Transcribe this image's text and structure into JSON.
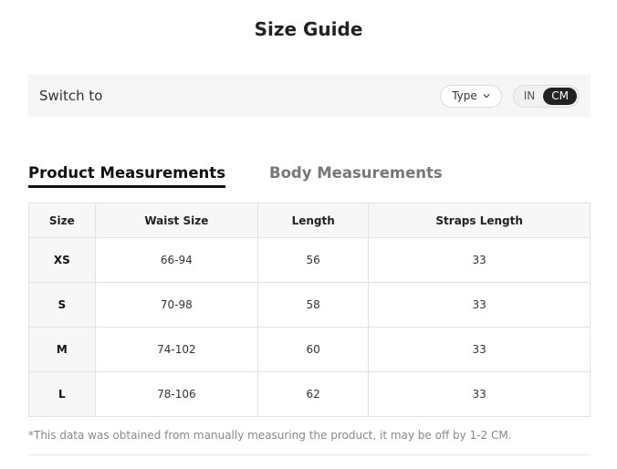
{
  "page": {
    "title": "Size Guide"
  },
  "switch_bar": {
    "label": "Switch to",
    "type_select": {
      "value": "Type",
      "icon": "chevron-down-icon"
    },
    "units": [
      {
        "label": "IN",
        "active": false
      },
      {
        "label": "CM",
        "active": true
      }
    ]
  },
  "tabs": [
    {
      "label": "Product Measurements",
      "active": true
    },
    {
      "label": "Body Measurements",
      "active": false
    }
  ],
  "table": {
    "headers": [
      "Size",
      "Waist Size",
      "Length",
      "Straps Length"
    ],
    "rows": [
      [
        "XS",
        "66-94",
        "56",
        "33"
      ],
      [
        "S",
        "70-98",
        "58",
        "33"
      ],
      [
        "M",
        "74-102",
        "60",
        "33"
      ],
      [
        "L",
        "78-106",
        "62",
        "33"
      ]
    ]
  },
  "note": "*This data was obtained from manually measuring the product, it may be off by 1-2 CM.",
  "colors": {
    "accent": "#222222",
    "bar_bg": "#f6f6f6",
    "border": "#e2e2e2"
  }
}
